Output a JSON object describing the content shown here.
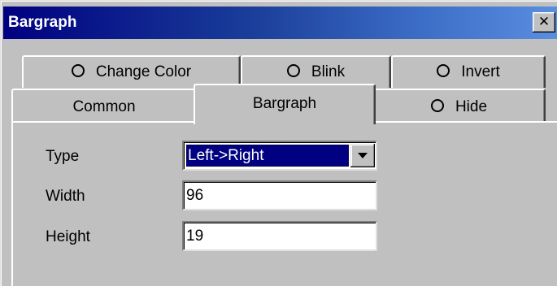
{
  "window": {
    "title": "Bargraph",
    "close_label": "✕"
  },
  "tabs_back": [
    "Change Color",
    "Blink",
    "Invert"
  ],
  "tabs_front": {
    "common": "Common",
    "bargraph": "Bargraph",
    "hide": "Hide"
  },
  "form": {
    "type_label": "Type",
    "type_value": "Left->Right",
    "width_label": "Width",
    "width_value": "96",
    "height_label": "Height",
    "height_value": "19"
  }
}
